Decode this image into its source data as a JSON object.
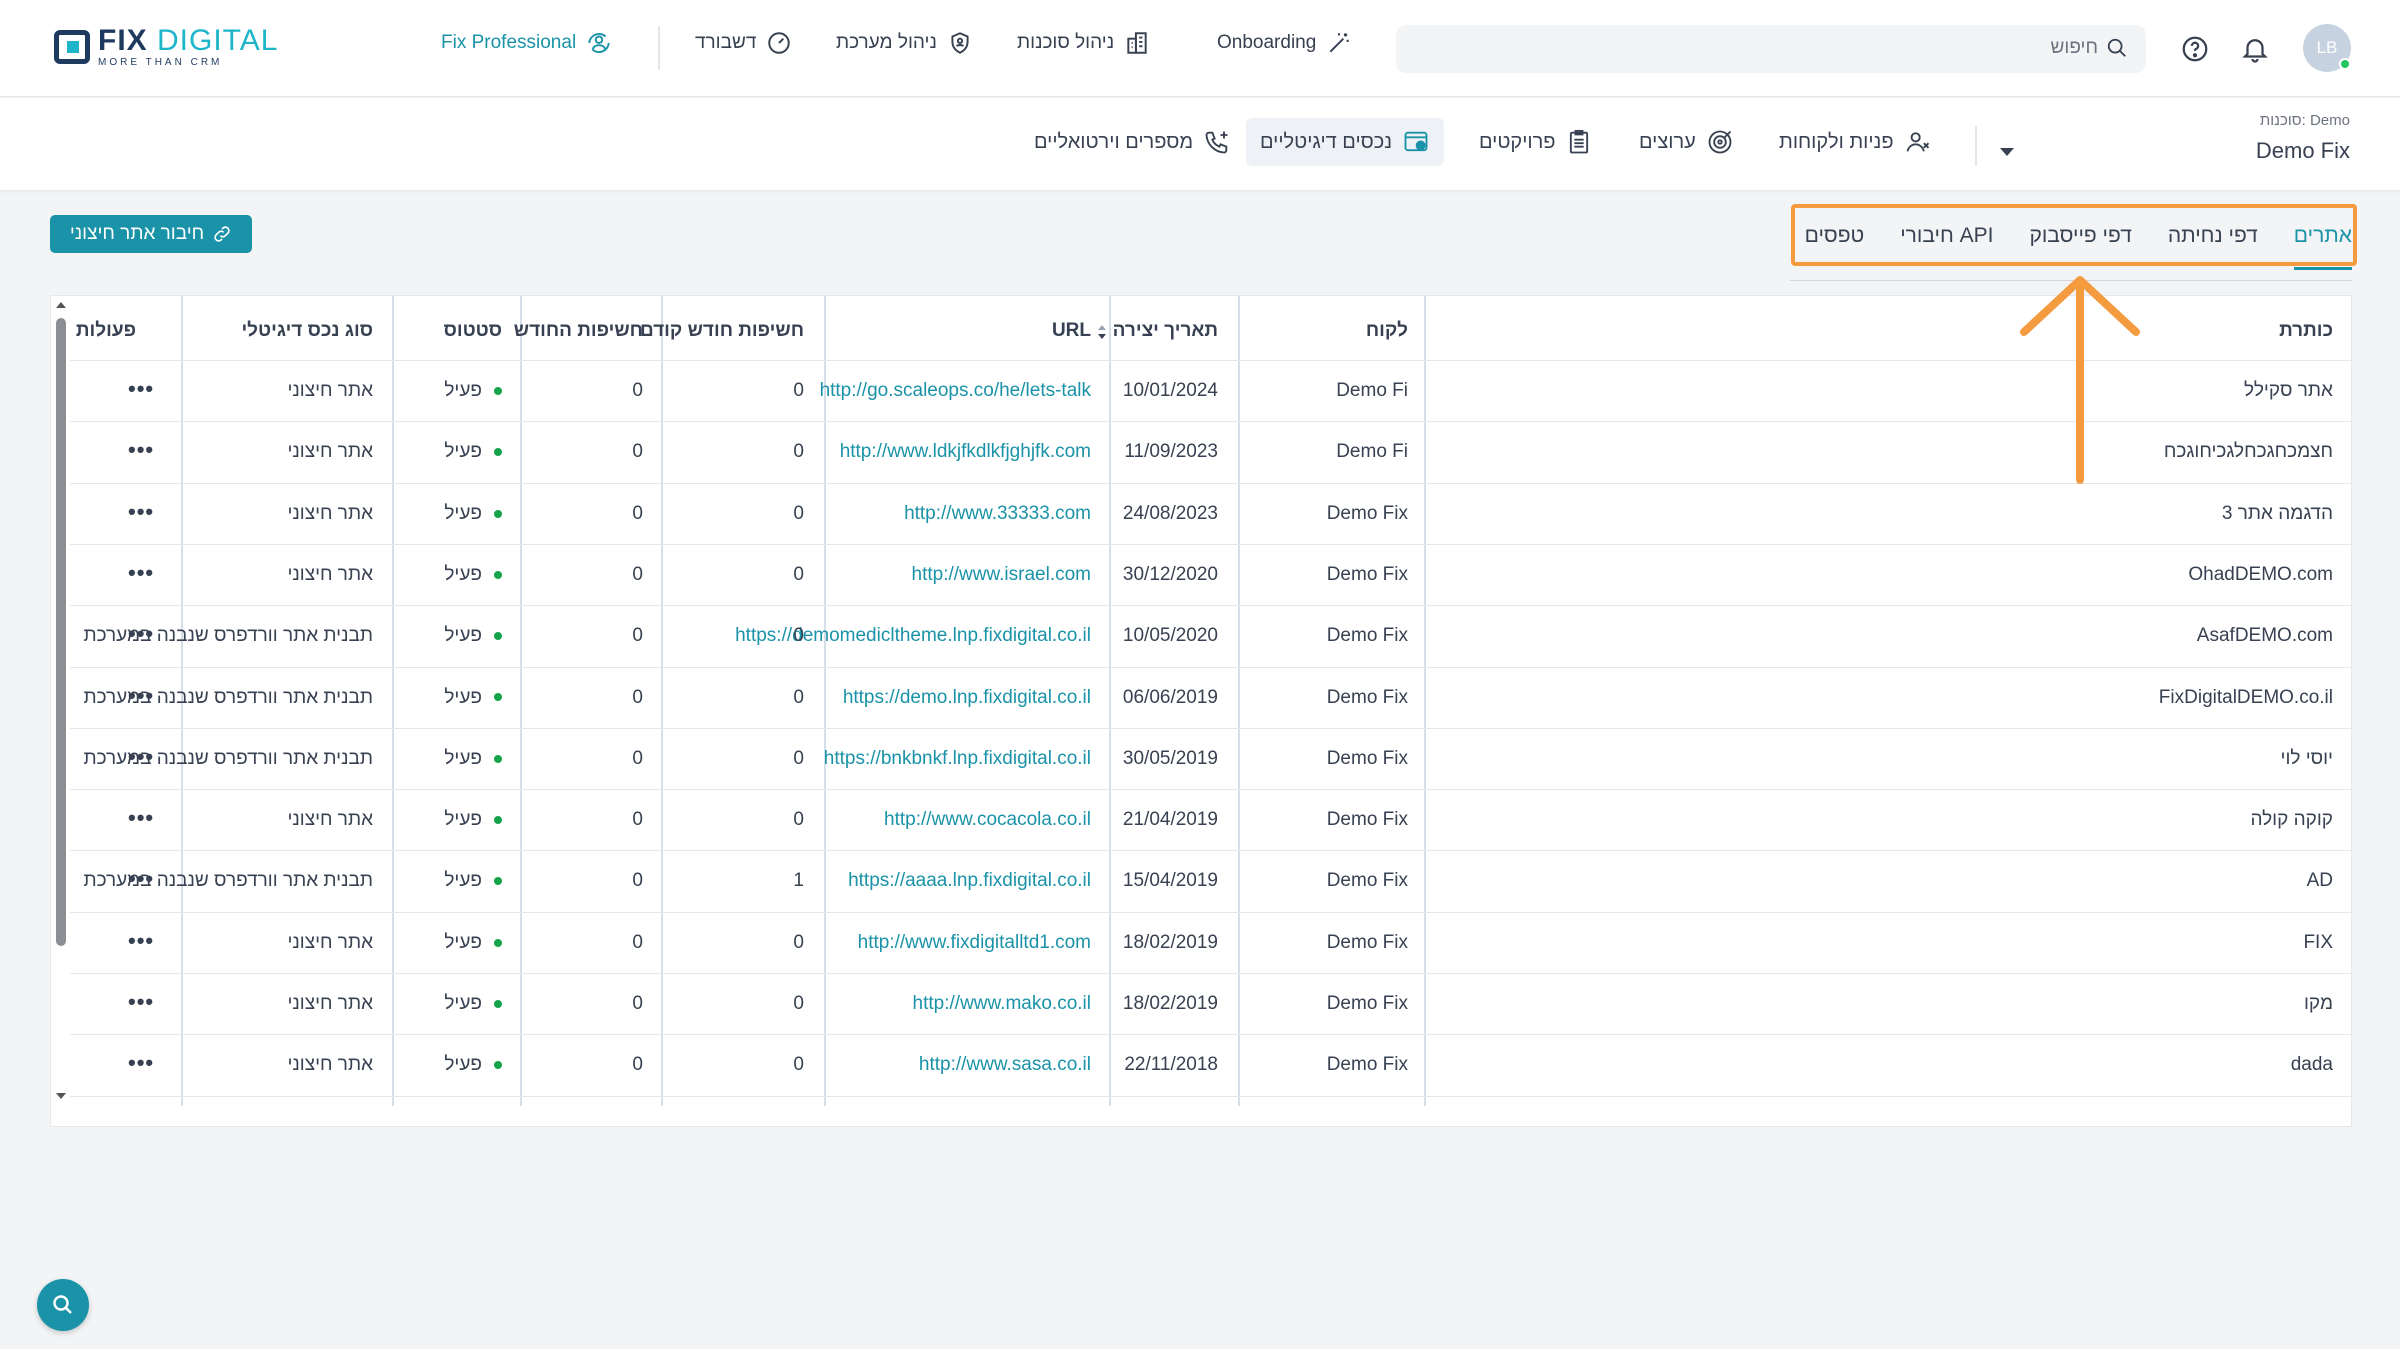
{
  "app": {
    "logo_main": "FIX",
    "logo_accent": "DIGITAL",
    "logo_sub": "MORE THAN CRM"
  },
  "topnav": {
    "fix_professional": "Fix Professional",
    "dashboard": "דשבורד",
    "system_management": "ניהול מערכת",
    "agencies_management": "ניהול סוכנות",
    "onboarding": "Onboarding",
    "search_placeholder": "חיפוש",
    "avatar_initials": "LB"
  },
  "agency": {
    "label": "סוכנות: Demo",
    "name": "Demo Fix"
  },
  "modules": {
    "leads_customers": "פניות ולקוחות",
    "offers": "ערוצים",
    "projects": "פרויקטים",
    "digital_assets": "נכסים דיגיטליים",
    "virtual_numbers": "מספרים וירטואליים"
  },
  "tabs": [
    "אתרים",
    "דפי נחיתה",
    "דפי פייסבוק",
    "חיבורי API",
    "טפסים"
  ],
  "connect_button": "חיבור אתר חיצוני",
  "table": {
    "headers": {
      "title": "כותרת",
      "customer": "לקוח",
      "created": "תאריך יצירה",
      "url": "URL",
      "prev_month": "חשיפות חודש קודם",
      "this_month": "חשיפות החודש",
      "status": "סטטוס",
      "asset_type": "סוג נכס דיגיטלי",
      "actions": "פעולות"
    },
    "actions_glyph": "•••",
    "rows": [
      {
        "title": "אתר סקילל",
        "customer": "Demo Fi",
        "created": "10/01/2024",
        "url": "http://go.scaleops.co/he/lets-talk",
        "prev": "0",
        "cur": "0",
        "status": "פעיל",
        "type": "אתר חיצוני"
      },
      {
        "title": "חצמכחגכחלגכיחוגכח",
        "customer": "Demo Fi",
        "created": "11/09/2023",
        "url": "http://www.ldkjfkdlkfjghjfk.com",
        "prev": "0",
        "cur": "0",
        "status": "פעיל",
        "type": "אתר חיצוני"
      },
      {
        "title": "הדגמה אתר 3",
        "customer": "Demo Fix",
        "created": "24/08/2023",
        "url": "http://www.33333.com",
        "prev": "0",
        "cur": "0",
        "status": "פעיל",
        "type": "אתר חיצוני"
      },
      {
        "title": "OhadDEMO.com",
        "customer": "Demo Fix",
        "created": "30/12/2020",
        "url": "http://www.israel.com",
        "prev": "0",
        "cur": "0",
        "status": "פעיל",
        "type": "אתר חיצוני"
      },
      {
        "title": "AsafDEMO.com",
        "customer": "Demo Fix",
        "created": "10/05/2020",
        "url": "https://demomedicltheme.lnp.fixdigital.co.il",
        "prev": "0",
        "cur": "0",
        "status": "פעיל",
        "type": "תבנית אתר וורדפרס שנבנה במערכת"
      },
      {
        "title": "FixDigitalDEMO.co.il",
        "customer": "Demo Fix",
        "created": "06/06/2019",
        "url": "https://demo.lnp.fixdigital.co.il",
        "prev": "0",
        "cur": "0",
        "status": "פעיל",
        "type": "תבנית אתר וורדפרס שנבנה במערכת"
      },
      {
        "title": "יוסי לוי",
        "customer": "Demo Fix",
        "created": "30/05/2019",
        "url": "https://bnkbnkf.lnp.fixdigital.co.il",
        "prev": "0",
        "cur": "0",
        "status": "פעיל",
        "type": "תבנית אתר וורדפרס שנבנה במערכת"
      },
      {
        "title": "קוקה קולה",
        "customer": "Demo Fix",
        "created": "21/04/2019",
        "url": "http://www.cocacola.co.il",
        "prev": "0",
        "cur": "0",
        "status": "פעיל",
        "type": "אתר חיצוני"
      },
      {
        "title": "AD",
        "customer": "Demo Fix",
        "created": "15/04/2019",
        "url": "https://aaaa.lnp.fixdigital.co.il",
        "prev": "1",
        "cur": "0",
        "status": "פעיל",
        "type": "תבנית אתר וורדפרס שנבנה במערכת"
      },
      {
        "title": "FIX",
        "customer": "Demo Fix",
        "created": "18/02/2019",
        "url": "http://www.fixdigitalltd1.com",
        "prev": "0",
        "cur": "0",
        "status": "פעיל",
        "type": "אתר חיצוני"
      },
      {
        "title": "מקו",
        "customer": "Demo Fix",
        "created": "18/02/2019",
        "url": "http://www.mako.co.il",
        "prev": "0",
        "cur": "0",
        "status": "פעיל",
        "type": "אתר חיצוני"
      },
      {
        "title": "dada",
        "customer": "Demo Fix",
        "created": "22/11/2018",
        "url": "http://www.sasa.co.il",
        "prev": "0",
        "cur": "0",
        "status": "פעיל",
        "type": "אתר חיצוני"
      }
    ]
  },
  "colors": {
    "accent": "#1a93a8",
    "highlight": "#f49b3f",
    "status_active": "#16a34a"
  }
}
